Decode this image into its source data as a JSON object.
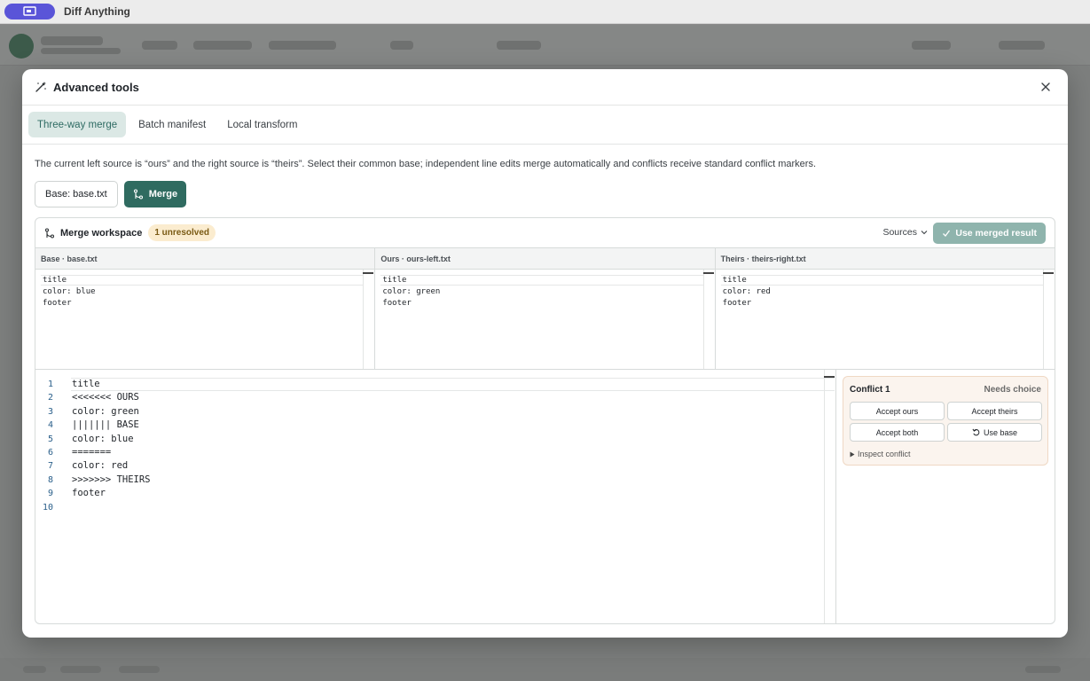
{
  "app": {
    "title": "Diff Anything"
  },
  "modal": {
    "title": "Advanced tools",
    "tabs": [
      {
        "label": "Three-way merge",
        "active": true
      },
      {
        "label": "Batch manifest",
        "active": false
      },
      {
        "label": "Local transform",
        "active": false
      }
    ],
    "description": "The current left source is “ours” and the right source is “theirs”. Select their common base; independent line edits merge automatically and conflicts receive standard conflict markers.",
    "base_button": "Base: base.txt",
    "merge_button": "Merge"
  },
  "workspace": {
    "title": "Merge workspace",
    "badge": "1 unresolved",
    "sources_label": "Sources",
    "use_merged_label": "Use merged result",
    "panes": [
      {
        "header": "Base · base.txt",
        "content": "title\ncolor: blue\nfooter"
      },
      {
        "header": "Ours · ours-left.txt",
        "content": "title\ncolor: green\nfooter"
      },
      {
        "header": "Theirs · theirs-right.txt",
        "content": "title\ncolor: red\nfooter"
      }
    ],
    "merged": {
      "line_numbers": "1\n2\n3\n4\n5\n6\n7\n8\n9\n10",
      "content": "title\n<<<<<<< OURS\ncolor: green\n||||||| BASE\ncolor: blue\n=======\ncolor: red\n>>>>>>> THEIRS\nfooter\n"
    },
    "conflict": {
      "title": "Conflict 1",
      "status": "Needs choice",
      "accept_ours": "Accept ours",
      "accept_theirs": "Accept theirs",
      "accept_both": "Accept both",
      "use_base": "Use base",
      "inspect": "Inspect conflict"
    }
  },
  "colors": {
    "accent": "#2f6b60",
    "active_tab_bg": "#dbe8e5",
    "badge_bg": "#fbeccf",
    "app_pill": "#5a55d8"
  }
}
